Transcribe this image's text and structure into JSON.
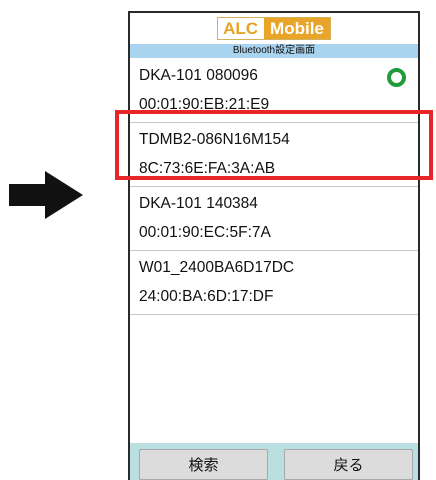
{
  "app": {
    "logo_part1": "ALC",
    "logo_part2": "Mobile",
    "screen_title": "Bluetooth設定画面"
  },
  "devices": [
    {
      "name": "DKA-101 080096",
      "mac": "00:01:90:EB:21:E9",
      "connected": true
    },
    {
      "name": "TDMB2-086N16M154",
      "mac": "8C:73:6E:FA:3A:AB",
      "connected": false,
      "highlighted": true
    },
    {
      "name": "DKA-101 140384",
      "mac": "00:01:90:EC:5F:7A",
      "connected": false
    },
    {
      "name": "W01_2400BA6D17DC",
      "mac": "24:00:BA:6D:17:DF",
      "connected": false
    }
  ],
  "buttons": {
    "search": "検索",
    "back": "戻る"
  },
  "colors": {
    "highlight": "#e8262a",
    "connected_indicator": "#1f9b3a",
    "title_bar": "#a8d4ef",
    "bottom_bar": "#b9dfe0",
    "logo_accent": "#e8a52a"
  },
  "icons": {
    "arrow": "arrow-right-icon",
    "status": "connected-ring-icon"
  }
}
